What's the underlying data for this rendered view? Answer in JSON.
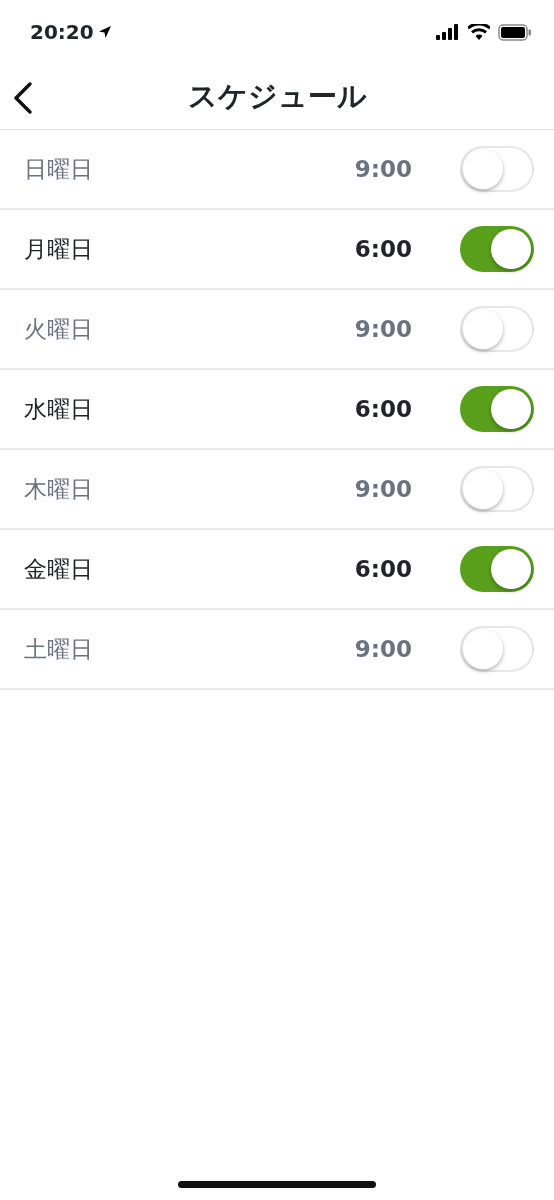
{
  "status_bar": {
    "time": "20:20"
  },
  "header": {
    "title": "スケジュール"
  },
  "schedule": [
    {
      "day": "日曜日",
      "time": "9:00",
      "on": false
    },
    {
      "day": "月曜日",
      "time": "6:00",
      "on": true
    },
    {
      "day": "火曜日",
      "time": "9:00",
      "on": false
    },
    {
      "day": "水曜日",
      "time": "6:00",
      "on": true
    },
    {
      "day": "木曜日",
      "time": "9:00",
      "on": false
    },
    {
      "day": "金曜日",
      "time": "6:00",
      "on": true
    },
    {
      "day": "土曜日",
      "time": "9:00",
      "on": false
    }
  ]
}
